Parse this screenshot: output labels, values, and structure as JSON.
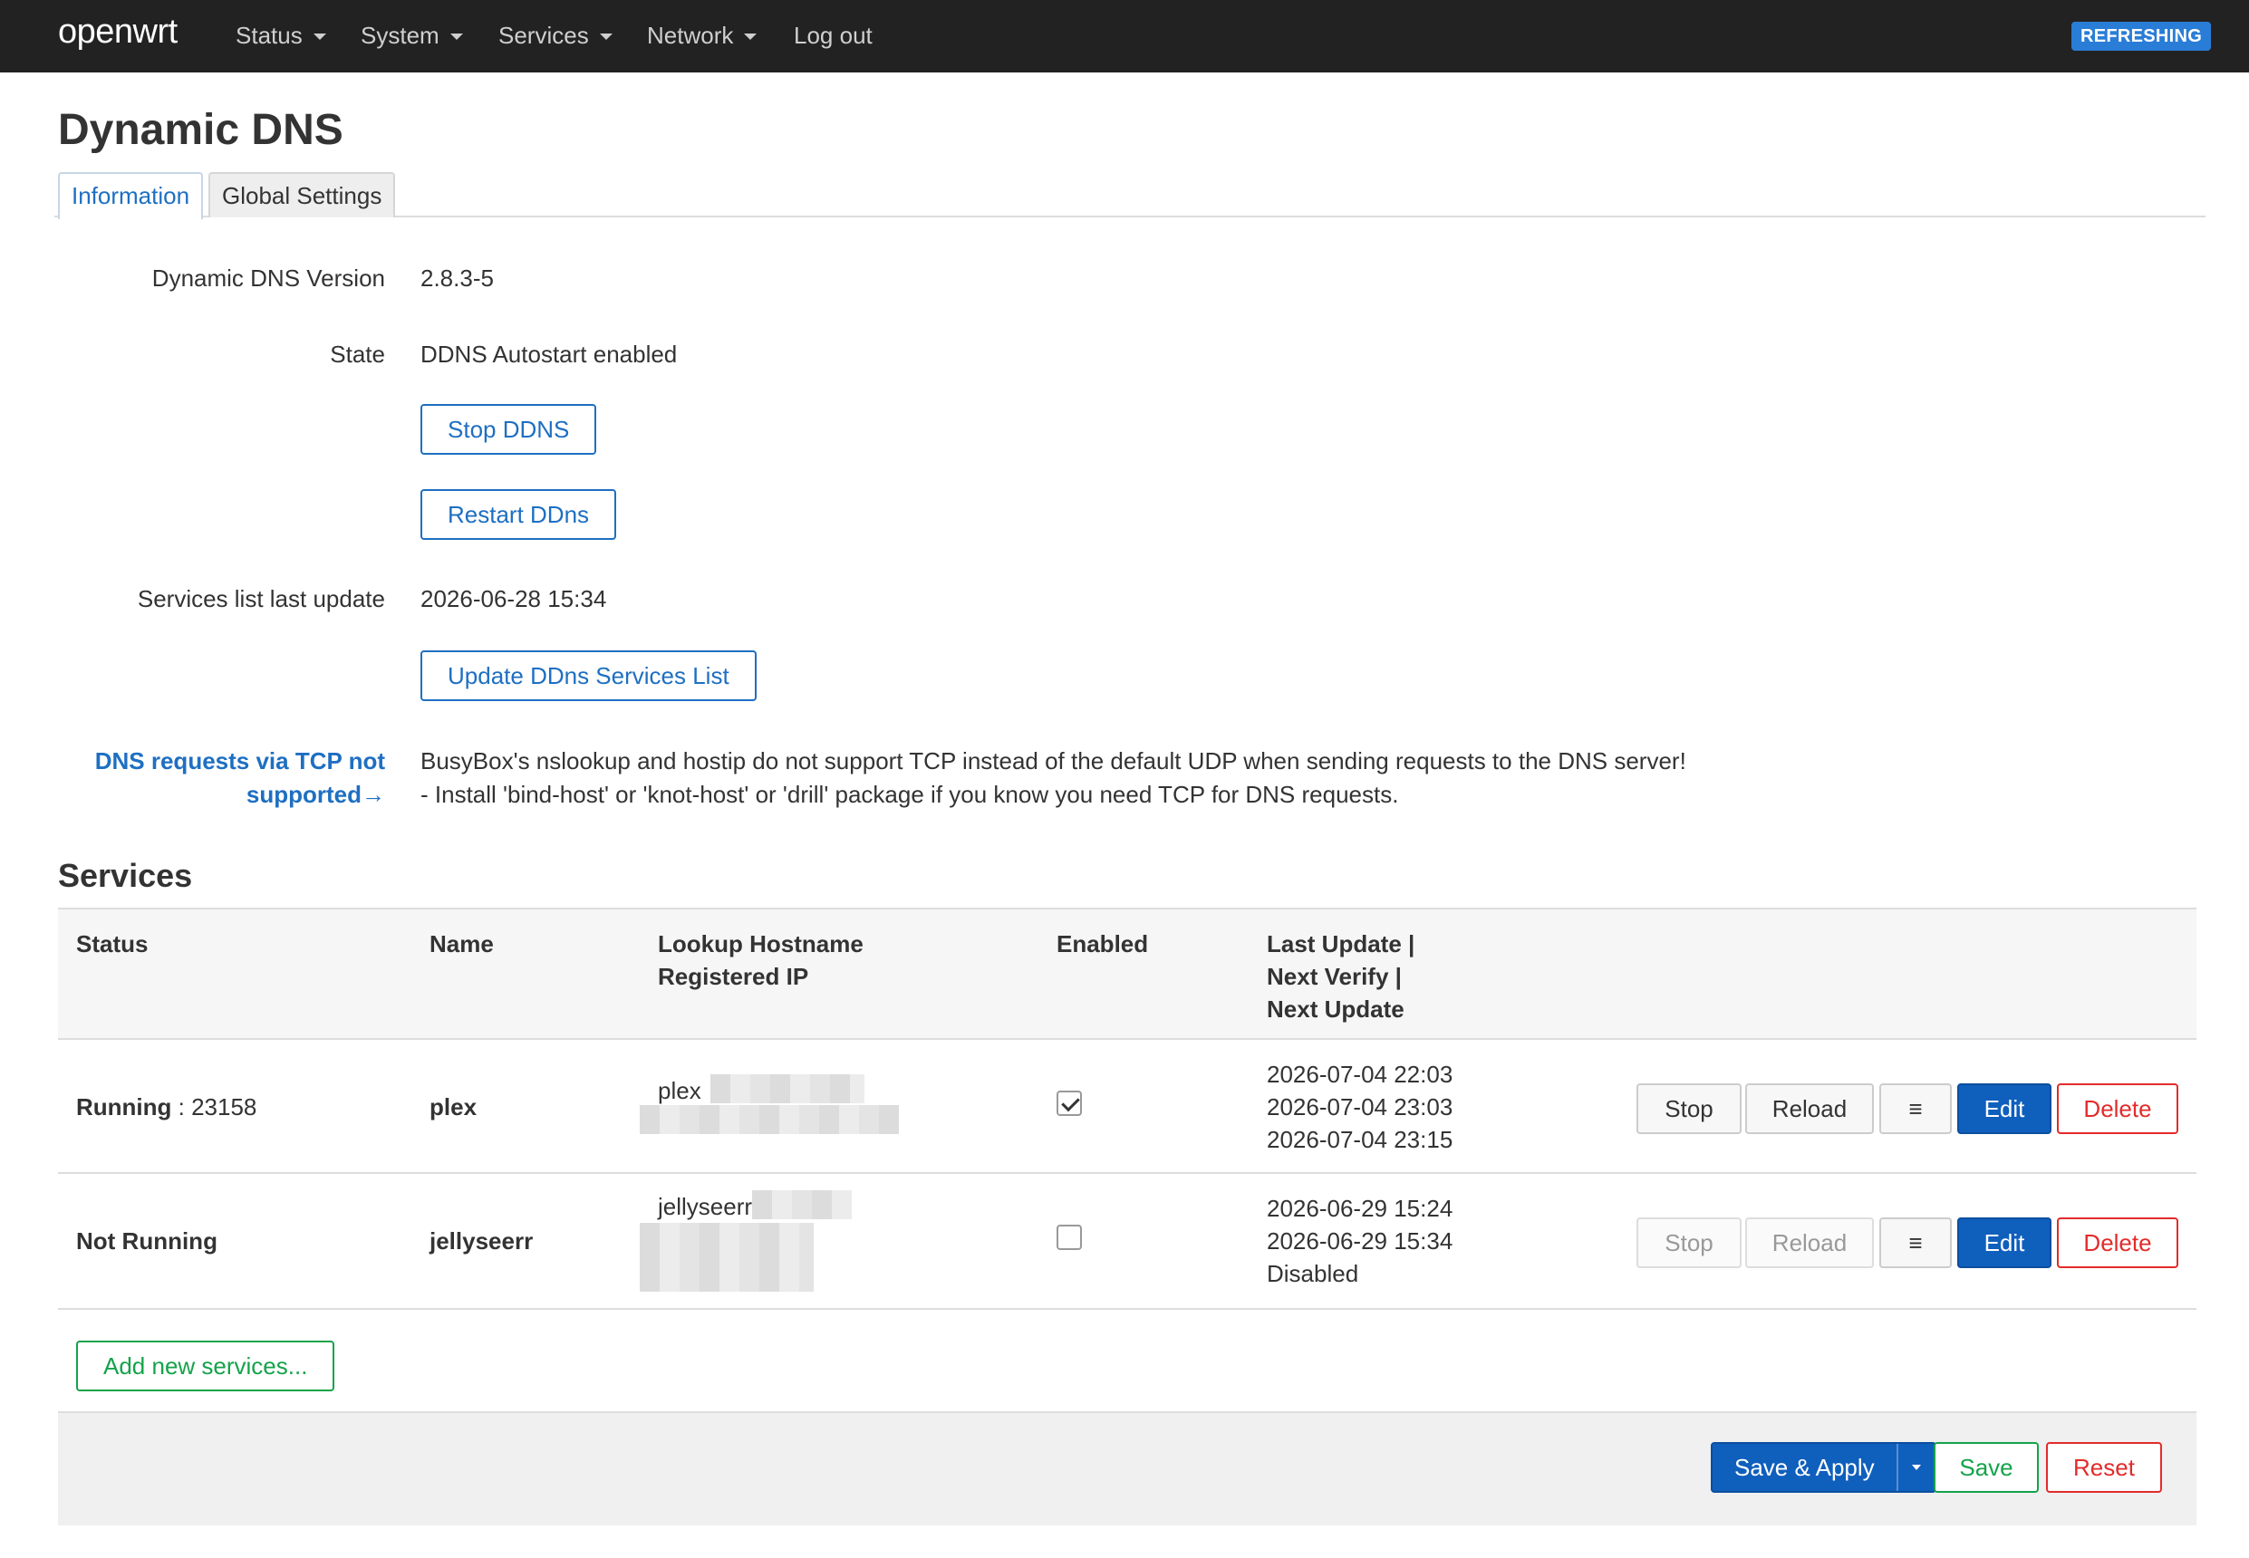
{
  "brand": "openwrt",
  "nav": {
    "items": [
      {
        "label": "Status",
        "has_menu": true
      },
      {
        "label": "System",
        "has_menu": true
      },
      {
        "label": "Services",
        "has_menu": true
      },
      {
        "label": "Network",
        "has_menu": true
      },
      {
        "label": "Log out",
        "has_menu": false
      }
    ],
    "badge": "REFRESHING",
    "badge_color": "#2a7dd6"
  },
  "page_title": "Dynamic DNS",
  "tabs": [
    {
      "label": "Information",
      "active": true
    },
    {
      "label": "Global Settings",
      "active": false
    }
  ],
  "info": {
    "version_label": "Dynamic DNS Version",
    "version_value": "2.8.3-5",
    "state_label": "State",
    "state_value": "DDNS Autostart enabled",
    "stop_btn": "Stop DDNS",
    "restart_btn": "Restart DDns",
    "services_update_label": "Services list last update",
    "services_update_value": "2026-06-28 15:34",
    "update_list_btn": "Update DDns Services List",
    "warning_label_line1": "DNS requests via TCP not",
    "warning_label_line2": "supported→",
    "warning_text_line1": "BusyBox's nslookup and hostip do not support TCP instead of the default UDP when sending requests to the DNS server!",
    "warning_text_line2": "- Install 'bind-host' or 'knot-host' or 'drill' package if you know you need TCP for DNS requests."
  },
  "services": {
    "title": "Services",
    "headers": {
      "status": "Status",
      "name": "Name",
      "lookup_line1": "Lookup Hostname",
      "lookup_line2": "Registered IP",
      "enabled": "Enabled",
      "last_line1": "Last Update |",
      "last_line2": "Next Verify |",
      "last_line3": "Next Update"
    },
    "rows": [
      {
        "status_bold": "Running",
        "status_rest": " : 23158",
        "name": "plex",
        "hostname": "plex",
        "enabled": true,
        "last_update": "2026-07-04 22:03",
        "next_verify": "2026-07-04 23:03",
        "next_update": "2026-07-04 23:15",
        "stop": "Stop",
        "reload": "Reload",
        "menu": "≡",
        "edit": "Edit",
        "delete": "Delete"
      },
      {
        "status_bold": "Not Running",
        "status_rest": "",
        "name": "jellyseerr",
        "hostname": "jellyseerr",
        "enabled": false,
        "last_update": "2026-06-29 15:24",
        "next_verify": "2026-06-29 15:34",
        "next_update": "Disabled",
        "stop": "Stop",
        "reload": "Reload",
        "menu": "≡",
        "edit": "Edit",
        "delete": "Delete"
      }
    ],
    "add_btn": "Add new services..."
  },
  "footer": {
    "save_apply": "Save & Apply",
    "save": "Save",
    "reset": "Reset"
  },
  "colors": {
    "primary": "#0f5fbd",
    "link": "#1e6fc2",
    "success": "#14a34a",
    "danger": "#e32b2b",
    "navbar": "#222222"
  }
}
